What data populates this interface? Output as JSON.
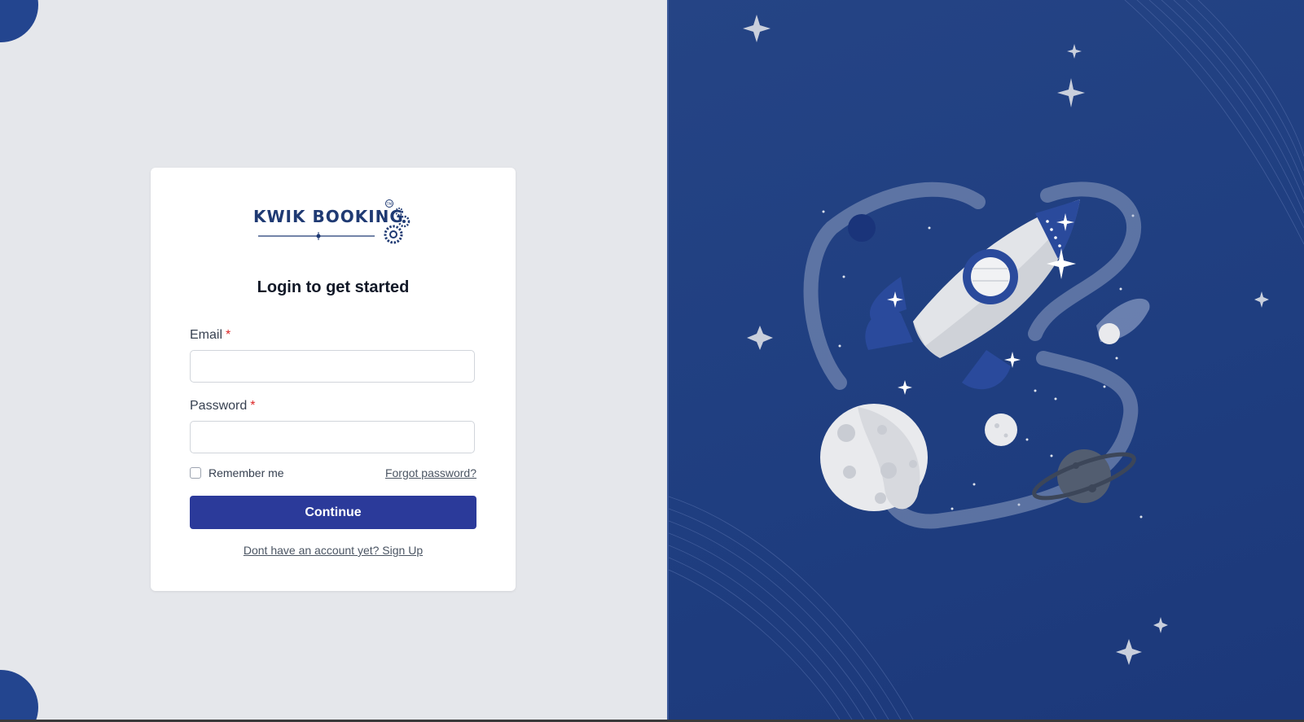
{
  "brand": {
    "logo_text": "KWIK BOOKING",
    "brand_color": "#1f3a73"
  },
  "login": {
    "title": "Login to get started",
    "email_label": "Email",
    "email_value": "",
    "password_label": "Password",
    "password_value": "",
    "required_marker": "*",
    "remember_label": "Remember me",
    "remember_checked": false,
    "forgot_label": "Forgot password?",
    "continue_label": "Continue",
    "signup_label": "Dont have an account yet? Sign Up"
  },
  "colors": {
    "primary_button": "#2b3a9a",
    "panel_background": "#1f3e82",
    "page_background": "#e5e7eb",
    "required": "#dc2626"
  },
  "illustration": {
    "icons": [
      "rocket-icon",
      "moon-icon",
      "planet-icon",
      "star-icon"
    ]
  }
}
